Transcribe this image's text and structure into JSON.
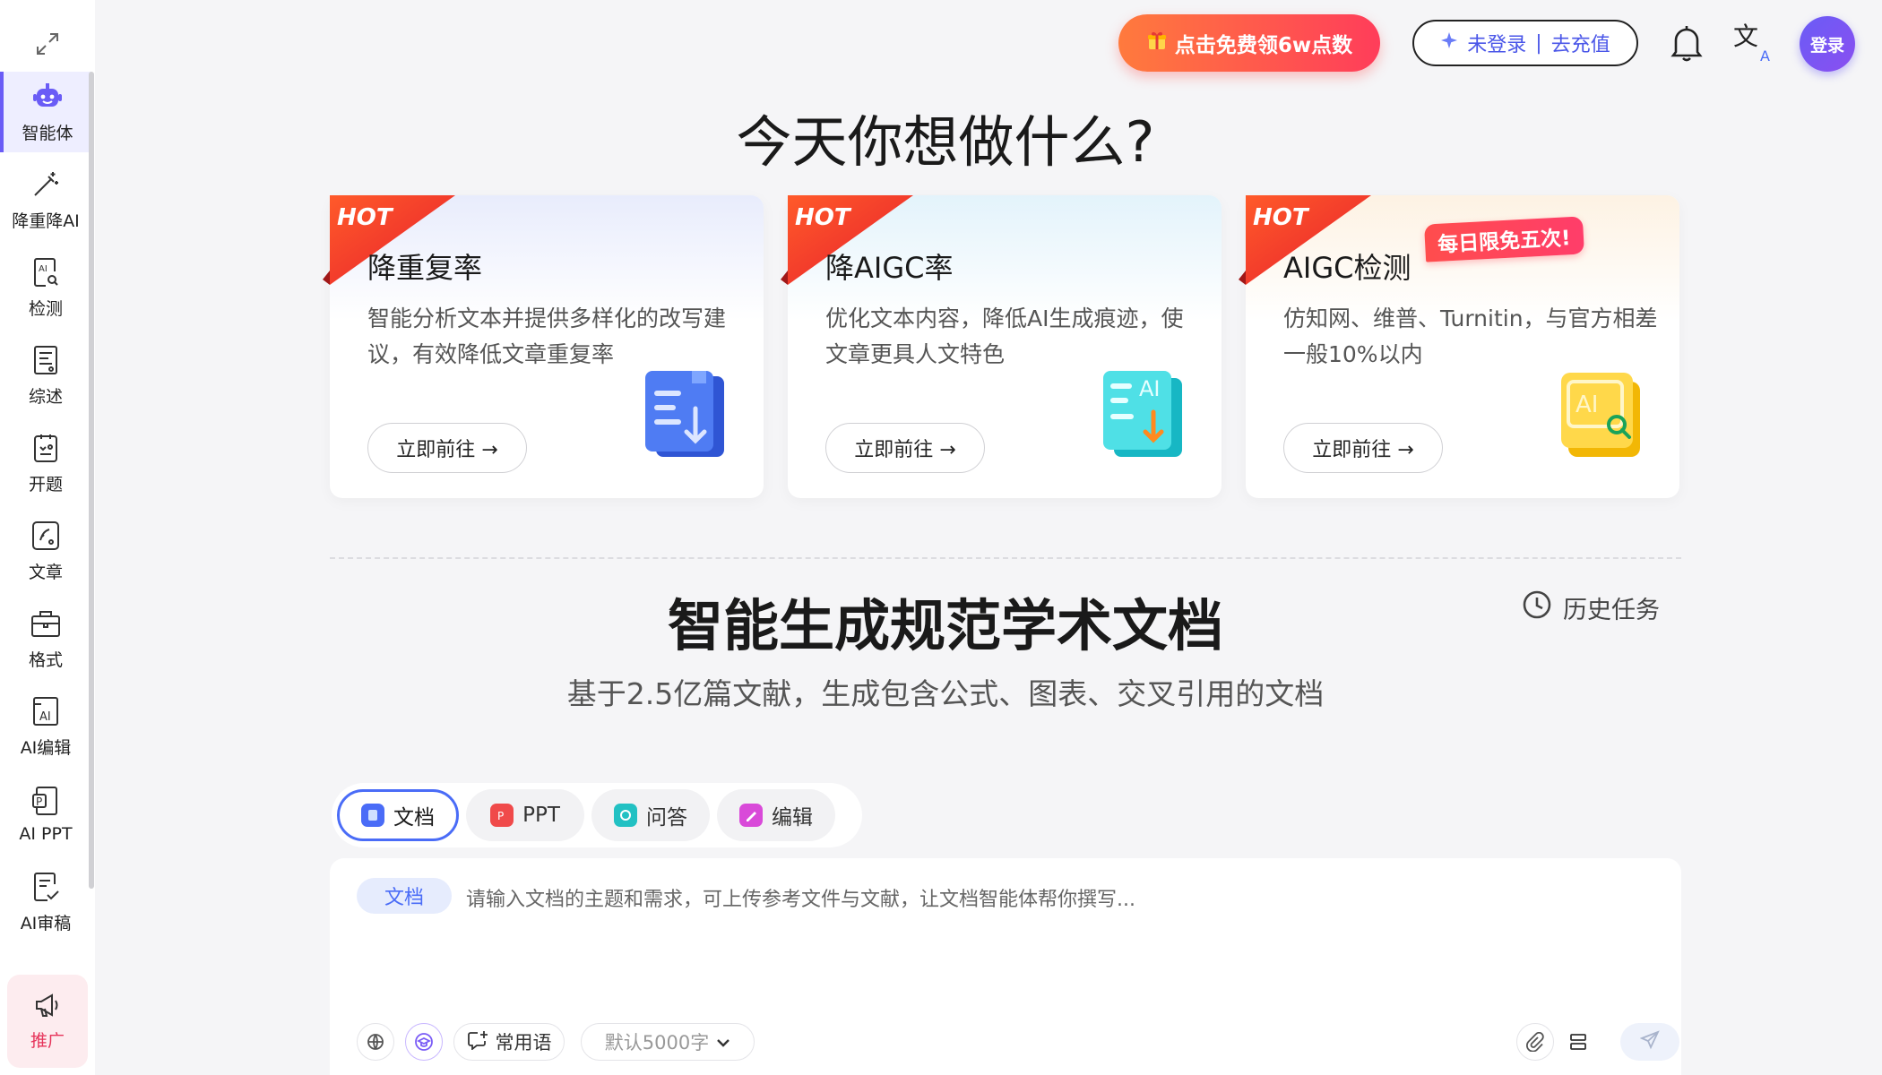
{
  "sidebar": {
    "items": [
      {
        "label": "智能体",
        "icon": "robot-icon",
        "active": true
      },
      {
        "label": "降重降AI",
        "icon": "magic-wand-icon",
        "active": false
      },
      {
        "label": "检测",
        "icon": "ai-search-icon",
        "active": false
      },
      {
        "label": "综述",
        "icon": "review-doc-icon",
        "active": false
      },
      {
        "label": "开题",
        "icon": "proposal-icon",
        "active": false
      },
      {
        "label": "文章",
        "icon": "article-icon",
        "active": false
      },
      {
        "label": "格式",
        "icon": "briefcase-icon",
        "active": false
      },
      {
        "label": "AI编辑",
        "icon": "ai-edit-icon",
        "active": false
      },
      {
        "label": "AI PPT",
        "icon": "ppt-icon",
        "active": false
      },
      {
        "label": "AI审稿",
        "icon": "review-check-icon",
        "active": false
      }
    ],
    "promo_label": "推广"
  },
  "topbar": {
    "gift_label": "点击免费领6w点数",
    "not_logged_in": "未登录",
    "separator": "|",
    "recharge": "去充值",
    "avatar_label": "登录"
  },
  "hero": {
    "title": "今天你想做什么?"
  },
  "cards": [
    {
      "badge": "HOT",
      "title": "降重复率",
      "desc": "智能分析文本并提供多样化的改写建议，有效降低文章重复率",
      "button": "立即前往 →",
      "icon": "document-download-icon"
    },
    {
      "badge": "HOT",
      "title": "降AIGC率",
      "desc": "优化文本内容，降低AI生成痕迹，使文章更具人文特色",
      "button": "立即前往 →",
      "icon": "ai-document-icon"
    },
    {
      "badge": "HOT",
      "title": "AIGC检测",
      "desc": "仿知网、维普、Turnitin，与官方相差一般10%以内",
      "button": "立即前往 →",
      "limit": "每日限免五次!",
      "icon": "ai-detect-icon"
    }
  ],
  "section": {
    "title": "智能生成规范学术文档",
    "subtitle": "基于2.5亿篇文献，生成包含公式、图表、交叉引用的文档",
    "history": "历史任务"
  },
  "tabs": [
    {
      "label": "文档",
      "active": true,
      "color": "#4a6cf7"
    },
    {
      "label": "PPT",
      "active": false,
      "color": "#f04a4a"
    },
    {
      "label": "问答",
      "active": false,
      "color": "#22c1c3"
    },
    {
      "label": "编辑",
      "active": false,
      "color": "#d94ad9"
    }
  ],
  "composer": {
    "chip": "文档",
    "placeholder": "请输入文档的主题和需求，可上传参考文件与文献，让文档智能体帮你撰写...",
    "common_phrases": "常用语",
    "word_limit": "默认5000字"
  },
  "colors": {
    "accent": "#6a5cf6",
    "blue": "#4a6cf7",
    "hot_red": "#ff3d3d"
  }
}
